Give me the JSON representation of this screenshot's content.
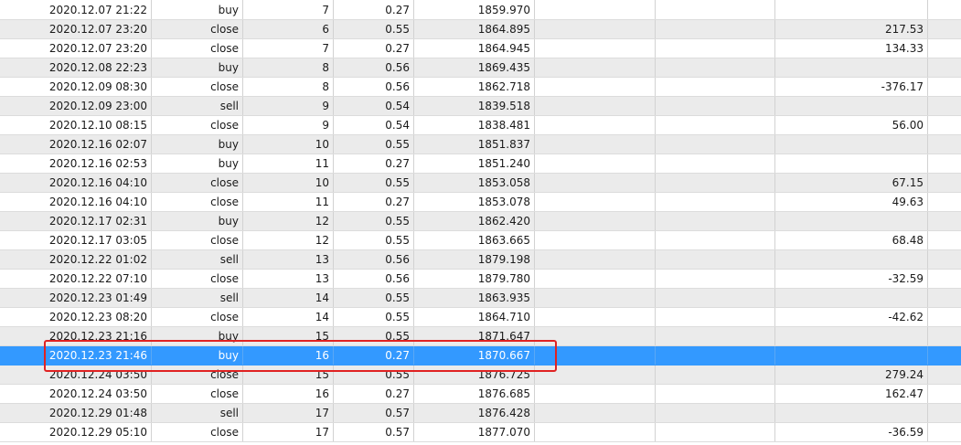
{
  "table": {
    "rows": [
      {
        "time": "2020.12.07 21:22",
        "type": "buy",
        "order": "7",
        "size": "0.27",
        "price": "1859.970",
        "profit": ""
      },
      {
        "time": "2020.12.07 23:20",
        "type": "close",
        "order": "6",
        "size": "0.55",
        "price": "1864.895",
        "profit": "217.53"
      },
      {
        "time": "2020.12.07 23:20",
        "type": "close",
        "order": "7",
        "size": "0.27",
        "price": "1864.945",
        "profit": "134.33"
      },
      {
        "time": "2020.12.08 22:23",
        "type": "buy",
        "order": "8",
        "size": "0.56",
        "price": "1869.435",
        "profit": ""
      },
      {
        "time": "2020.12.09 08:30",
        "type": "close",
        "order": "8",
        "size": "0.56",
        "price": "1862.718",
        "profit": "-376.17"
      },
      {
        "time": "2020.12.09 23:00",
        "type": "sell",
        "order": "9",
        "size": "0.54",
        "price": "1839.518",
        "profit": ""
      },
      {
        "time": "2020.12.10 08:15",
        "type": "close",
        "order": "9",
        "size": "0.54",
        "price": "1838.481",
        "profit": "56.00"
      },
      {
        "time": "2020.12.16 02:07",
        "type": "buy",
        "order": "10",
        "size": "0.55",
        "price": "1851.837",
        "profit": ""
      },
      {
        "time": "2020.12.16 02:53",
        "type": "buy",
        "order": "11",
        "size": "0.27",
        "price": "1851.240",
        "profit": ""
      },
      {
        "time": "2020.12.16 04:10",
        "type": "close",
        "order": "10",
        "size": "0.55",
        "price": "1853.058",
        "profit": "67.15"
      },
      {
        "time": "2020.12.16 04:10",
        "type": "close",
        "order": "11",
        "size": "0.27",
        "price": "1853.078",
        "profit": "49.63"
      },
      {
        "time": "2020.12.17 02:31",
        "type": "buy",
        "order": "12",
        "size": "0.55",
        "price": "1862.420",
        "profit": ""
      },
      {
        "time": "2020.12.17 03:05",
        "type": "close",
        "order": "12",
        "size": "0.55",
        "price": "1863.665",
        "profit": "68.48"
      },
      {
        "time": "2020.12.22 01:02",
        "type": "sell",
        "order": "13",
        "size": "0.56",
        "price": "1879.198",
        "profit": ""
      },
      {
        "time": "2020.12.22 07:10",
        "type": "close",
        "order": "13",
        "size": "0.56",
        "price": "1879.780",
        "profit": "-32.59"
      },
      {
        "time": "2020.12.23 01:49",
        "type": "sell",
        "order": "14",
        "size": "0.55",
        "price": "1863.935",
        "profit": ""
      },
      {
        "time": "2020.12.23 08:20",
        "type": "close",
        "order": "14",
        "size": "0.55",
        "price": "1864.710",
        "profit": "-42.62"
      },
      {
        "time": "2020.12.23 21:16",
        "type": "buy",
        "order": "15",
        "size": "0.55",
        "price": "1871.647",
        "profit": ""
      },
      {
        "time": "2020.12.23 21:46",
        "type": "buy",
        "order": "16",
        "size": "0.27",
        "price": "1870.667",
        "profit": ""
      },
      {
        "time": "2020.12.24 03:50",
        "type": "close",
        "order": "15",
        "size": "0.55",
        "price": "1876.725",
        "profit": "279.24"
      },
      {
        "time": "2020.12.24 03:50",
        "type": "close",
        "order": "16",
        "size": "0.27",
        "price": "1876.685",
        "profit": "162.47"
      },
      {
        "time": "2020.12.29 01:48",
        "type": "sell",
        "order": "17",
        "size": "0.57",
        "price": "1876.428",
        "profit": ""
      },
      {
        "time": "2020.12.29 05:10",
        "type": "close",
        "order": "17",
        "size": "0.57",
        "price": "1877.070",
        "profit": "-36.59"
      }
    ],
    "selected_row_index": 18
  },
  "colors": {
    "selection": "#3399ff",
    "highlight_box": "#e02222",
    "alt_row": "#ebebeb"
  }
}
